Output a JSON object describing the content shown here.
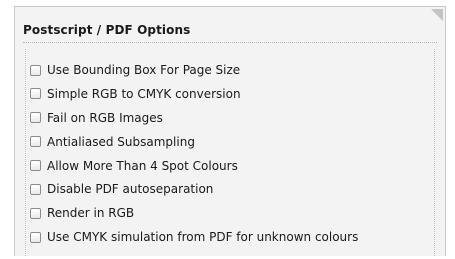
{
  "panel": {
    "title": "Postscript / PDF Options",
    "collapse_icon": "corner-triangle-icon"
  },
  "options": [
    {
      "label": "Use Bounding Box For Page Size",
      "checked": false
    },
    {
      "label": "Simple RGB to CMYK conversion",
      "checked": false
    },
    {
      "label": "Fail on RGB Images",
      "checked": false
    },
    {
      "label": "Antialiased Subsampling",
      "checked": false
    },
    {
      "label": "Allow More Than 4 Spot Colours",
      "checked": false
    },
    {
      "label": "Disable PDF autoseparation",
      "checked": false
    },
    {
      "label": "Render in RGB",
      "checked": false
    },
    {
      "label": "Use CMYK simulation from PDF for unknown colours",
      "checked": false
    }
  ],
  "colors": {
    "panel_background": "#f3f3f3",
    "panel_border": "#c9c9c9",
    "text": "#1a1a1a"
  }
}
